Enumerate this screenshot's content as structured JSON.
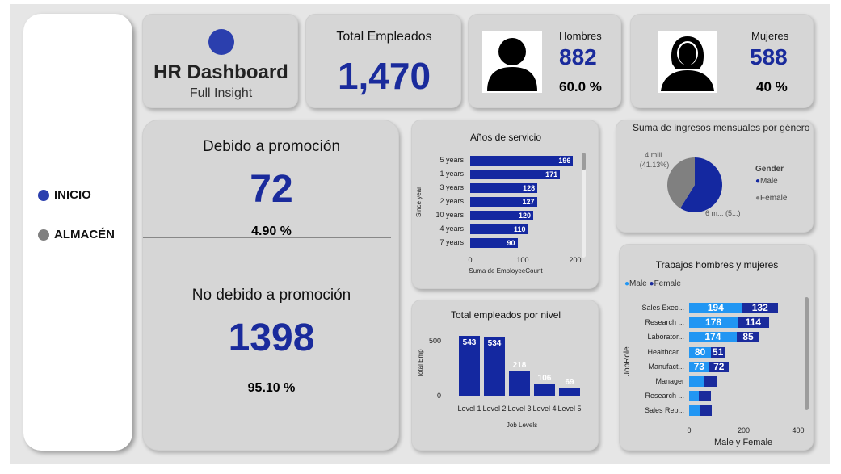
{
  "colors": {
    "accent": "#1a2b9c",
    "bar": "#1428a0",
    "male_light": "#2196f3",
    "female_dark": "#1a2b9c",
    "gray": "#808080"
  },
  "nav": [
    {
      "label": "INICIO",
      "dot_color": "#2b3fae"
    },
    {
      "label": "ALMACÉN",
      "dot_color": "#808080"
    }
  ],
  "header": {
    "title": "HR Dashboard",
    "subtitle": "Full Insight"
  },
  "kpi_total": {
    "label": "Total Empleados",
    "value": "1,470"
  },
  "kpi_men": {
    "label": "Hombres",
    "value": "882",
    "pct": "60.0 %",
    "icon": "man-silhouette-icon"
  },
  "kpi_women": {
    "label": "Mujeres",
    "value": "588",
    "pct": "40 %",
    "icon": "woman-silhouette-icon"
  },
  "promo": {
    "promo_label": "Debido a promoción",
    "promo_value": "72",
    "promo_pct": "4.90 %",
    "nopromo_label": "No debido a promoción",
    "nopromo_value": "1398",
    "nopromo_pct": "95.10 %"
  },
  "chart_data": [
    {
      "id": "years",
      "type": "bar",
      "orientation": "horizontal",
      "title": "Años de servicio",
      "xlabel": "Suma de EmployeeCount",
      "ylabel": "Since year",
      "categories": [
        "5 years",
        "1 years",
        "3 years",
        "2 years",
        "10 years",
        "4 years",
        "7 years"
      ],
      "values": [
        196,
        171,
        128,
        127,
        120,
        110,
        90
      ],
      "xlim": [
        0,
        200
      ],
      "xticks": [
        "0",
        "100",
        "200"
      ]
    },
    {
      "id": "levels",
      "type": "bar",
      "title": "Total empleados por nivel",
      "xlabel": "Job Levels",
      "ylabel": "Total Emp",
      "categories": [
        "Level 1",
        "Level 2",
        "Level 3",
        "Level 4",
        "Level 5"
      ],
      "values": [
        543,
        534,
        218,
        106,
        69
      ],
      "ylim": [
        0,
        543
      ],
      "yticks": [
        "500",
        "0"
      ]
    },
    {
      "id": "income",
      "type": "pie",
      "title": "Suma de ingresos mensuales por género",
      "legend_title": "Gender",
      "series": [
        {
          "name": "Male",
          "value": 58.87,
          "label": "6 m... (5...)",
          "color": "#1428a0"
        },
        {
          "name": "Female",
          "value": 41.13,
          "label": "4 mill. (41.13%)",
          "color": "#808080"
        }
      ],
      "legend_position": "right"
    },
    {
      "id": "jobs",
      "type": "bar",
      "orientation": "horizontal",
      "stacked": true,
      "title": "Trabajos hombres y mujeres",
      "xlabel": "Male y Female",
      "ylabel": "JobRole",
      "categories": [
        "Sales Exec...",
        "Research ...",
        "Laborator...",
        "Healthcar...",
        "Manufact...",
        "Manager",
        "Research ...",
        "Sales Rep..."
      ],
      "series": [
        {
          "name": "Male",
          "values": [
            194,
            178,
            174,
            80,
            73,
            54,
            37,
            38
          ]
        },
        {
          "name": "Female",
          "values": [
            132,
            114,
            85,
            51,
            72,
            48,
            43,
            45
          ]
        }
      ],
      "xlim": [
        0,
        400
      ],
      "xticks": [
        "0",
        "200",
        "400"
      ]
    }
  ]
}
